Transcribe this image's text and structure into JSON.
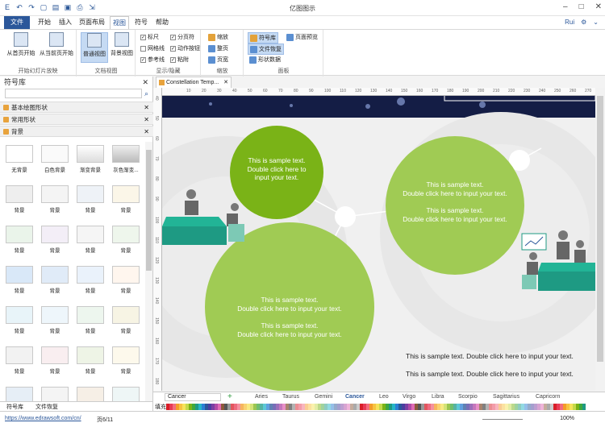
{
  "app": {
    "title": "亿图图示",
    "user": "Rui"
  },
  "ribbon": {
    "tabs": [
      "文件",
      "开始",
      "插入",
      "页面布局",
      "视图",
      "符号",
      "帮助"
    ],
    "groups": [
      {
        "label": "开始幻灯片放映",
        "buttons": [
          "从首页开始",
          "从当前页开始"
        ]
      },
      {
        "label": "文档视图",
        "buttons": [
          "普通视图",
          "背景视图"
        ]
      },
      {
        "label": "显示/隐藏",
        "checks": [
          "标尺",
          "分页符",
          "网格线",
          "动作按钮",
          "参考线",
          "粘附"
        ]
      },
      {
        "label": "缩放",
        "buttons": [
          "缩放",
          "整页",
          "页宽"
        ]
      },
      {
        "label": "面板",
        "buttons": [
          "符号库",
          "页面预览",
          "文件恢复",
          "形状数据"
        ]
      }
    ]
  },
  "left_panel": {
    "title": "符号库",
    "libraries": [
      "基本绘图形状",
      "常用形状",
      "背景"
    ],
    "shapes": [
      "无背景",
      "白色背景",
      "渐变背景",
      "灰色渐变...",
      "背景",
      "背景",
      "背景",
      "背景",
      "背景",
      "背景",
      "背景",
      "背景",
      "背景",
      "背景",
      "背景",
      "背景",
      "背景",
      "背景",
      "背景",
      "背景",
      "背景",
      "背景",
      "背景",
      "背景",
      "背景",
      "背景",
      "背景",
      "背景"
    ],
    "bottom_tabs": [
      "符号库",
      "文件恢复"
    ]
  },
  "document": {
    "tab": "Constellation Temp...",
    "ruler_x": [
      "10",
      "20",
      "30",
      "40",
      "50",
      "60",
      "70",
      "80",
      "90",
      "100",
      "110",
      "120",
      "130",
      "140",
      "150",
      "160",
      "170",
      "180",
      "190",
      "200",
      "210",
      "220",
      "230",
      "240",
      "250",
      "260",
      "270",
      "280"
    ],
    "ruler_y": [
      "40",
      "50",
      "60",
      "70",
      "80",
      "90",
      "100",
      "110",
      "120",
      "130",
      "140",
      "150",
      "160",
      "170",
      "180"
    ],
    "bubbles": [
      {
        "line1": "This is sample text.",
        "line2": "Double click here to",
        "line3": "input your text."
      },
      {
        "line1": "This is sample text.",
        "line2": "Double click here to input your text.",
        "line3": "This is sample text.",
        "line4": "Double click here to input your text."
      },
      {
        "line1": "This is sample text.",
        "line2": "Double click here to input your text.",
        "line3": "This is sample text.",
        "line4": "Double click here to input your text."
      }
    ],
    "dark_text": [
      "This is sample text. Double click here to input your text.",
      "This is sample text. Double click here to input your text."
    ]
  },
  "pages": {
    "current": "Cancer",
    "list": [
      "Aries",
      "Taurus",
      "Gemini",
      "Cancer",
      "Leo",
      "Virgo",
      "Libra",
      "Scorpio",
      "Sagittarius",
      "Capricorn"
    ]
  },
  "colors": {
    "label": "填充",
    "accent": "#2b579a",
    "dark_green": "#7ab317",
    "light_green": "#a0cb54",
    "navy": "#141d45",
    "teal": "#1e9a83"
  },
  "status": {
    "url": "https://www.edrawsoft.com/cn/",
    "page": "页6/11",
    "zoom": "100%"
  }
}
